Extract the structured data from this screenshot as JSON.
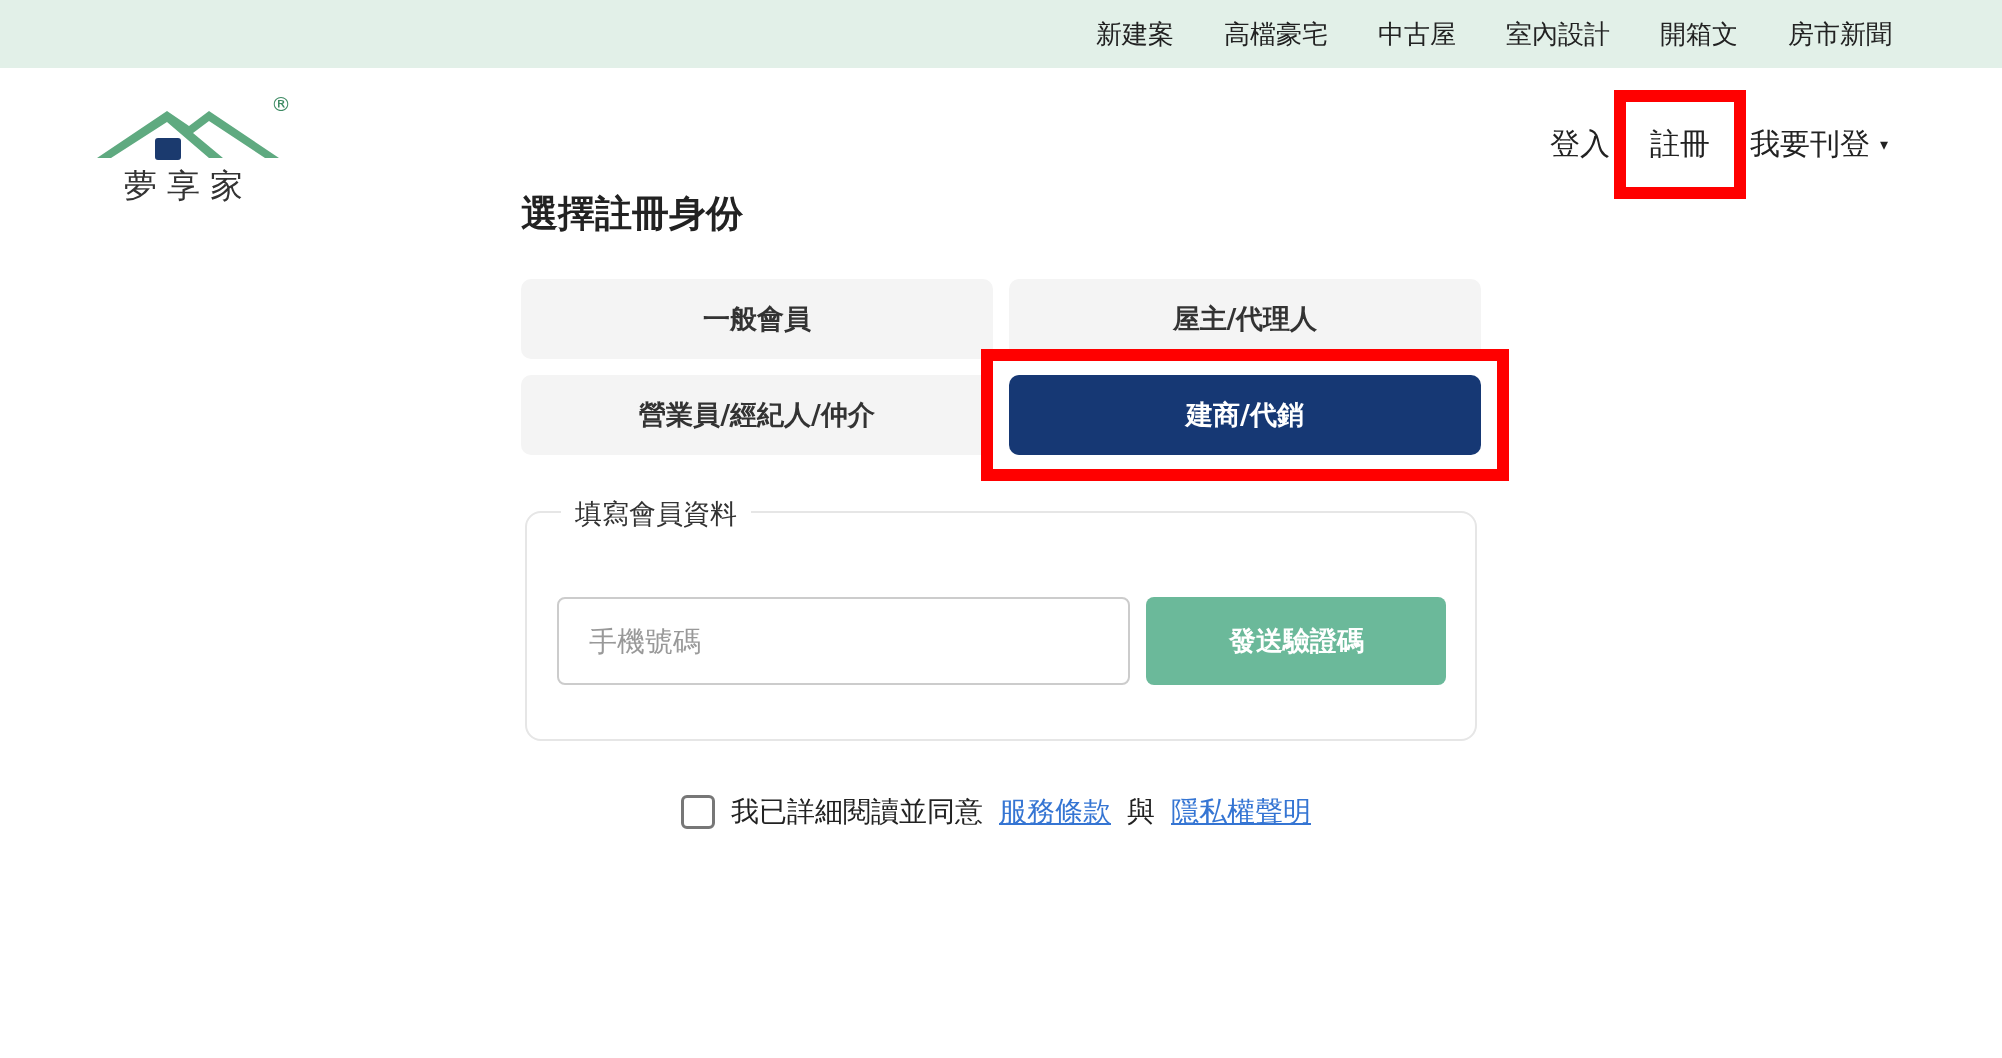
{
  "top_nav": [
    "新建案",
    "高檔豪宅",
    "中古屋",
    "室內設計",
    "開箱文",
    "房市新聞"
  ],
  "logo": {
    "name": "夢享家",
    "mark": "®"
  },
  "account_nav": [
    {
      "label": "登入",
      "highlighted": false,
      "kind": "link"
    },
    {
      "label": "註冊",
      "highlighted": true,
      "kind": "link"
    },
    {
      "label": "我要刊登",
      "highlighted": false,
      "kind": "dropdown",
      "caret": "▾"
    }
  ],
  "title": "選擇註冊身份",
  "roles": [
    {
      "label": "一般會員",
      "selected": false,
      "highlighted": false
    },
    {
      "label": "屋主/代理人",
      "selected": false,
      "highlighted": false
    },
    {
      "label": "營業員/經紀人/仲介",
      "selected": false,
      "highlighted": false
    },
    {
      "label": "建商/代銷",
      "selected": true,
      "highlighted": true
    }
  ],
  "form": {
    "legend": "填寫會員資料",
    "phone_placeholder": "手機號碼",
    "send_button": "發送驗證碼"
  },
  "agreement": {
    "checked": false,
    "text": "我已詳細閱讀並同意",
    "terms_link": "服務條款",
    "and": "與",
    "privacy_link": "隱私權聲明"
  }
}
